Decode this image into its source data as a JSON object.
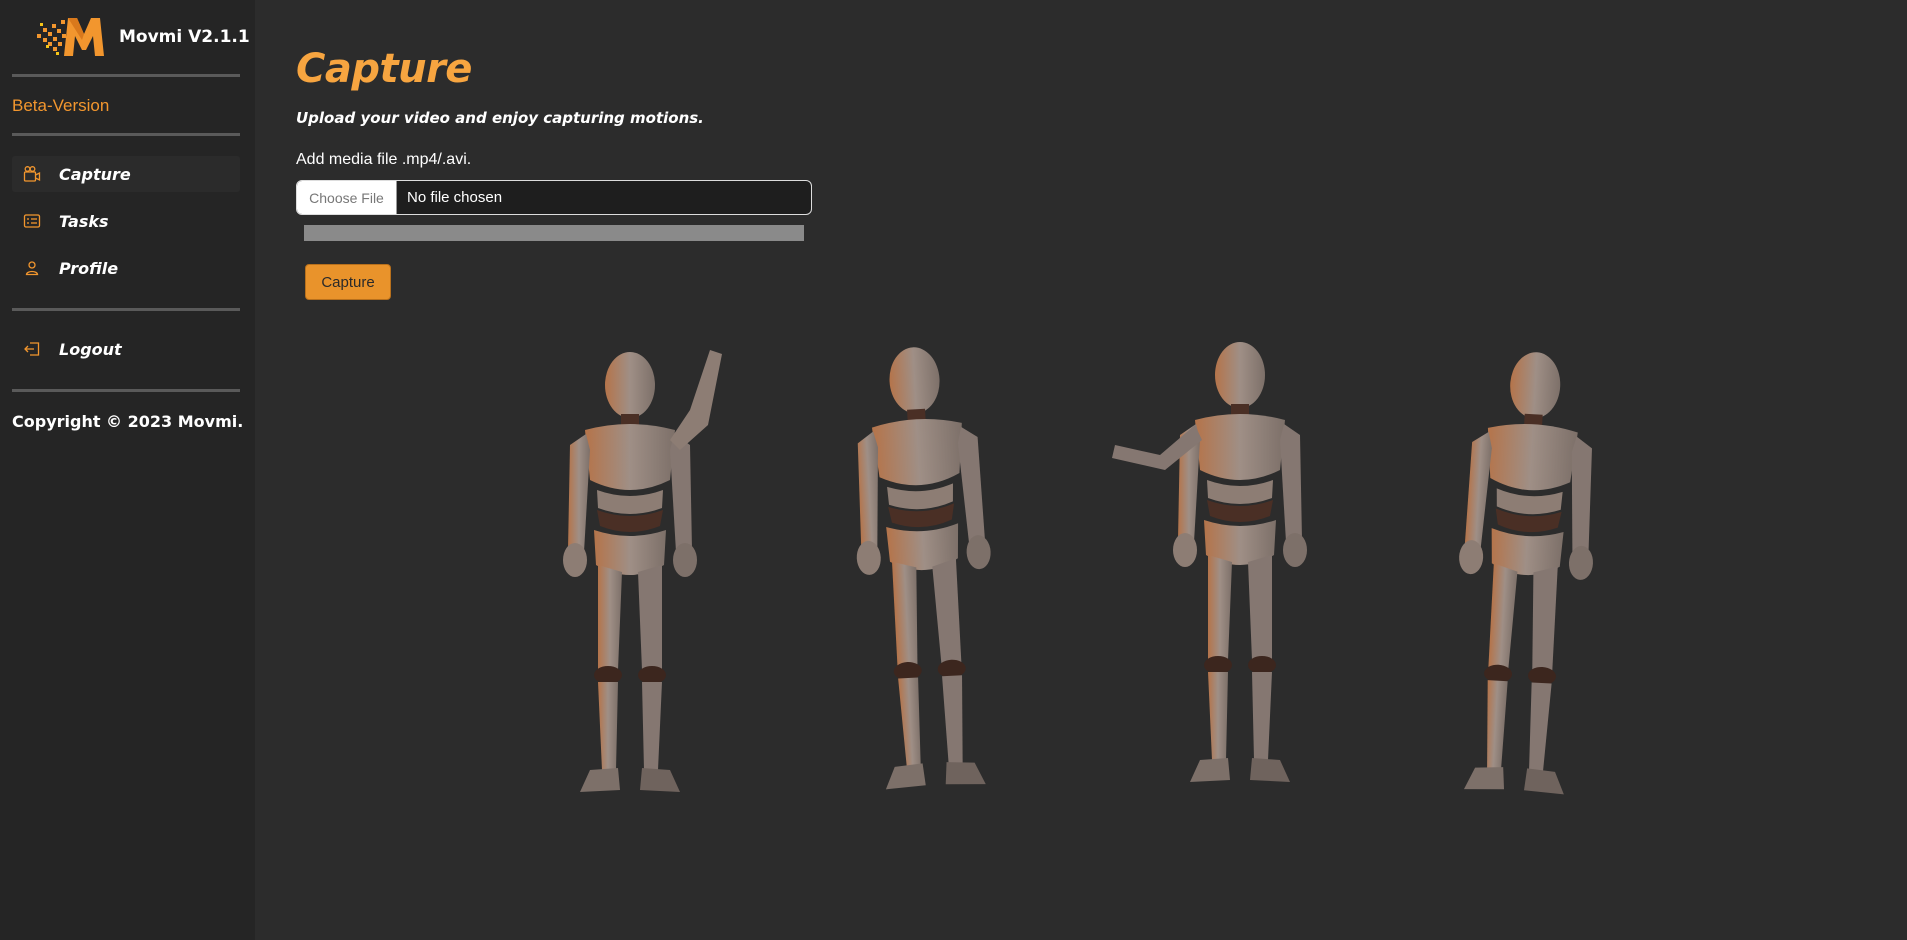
{
  "brand": {
    "name": "Movmi V2.1.1",
    "logo_icon": "movmi-m-logo",
    "logo_letter": "M"
  },
  "sidebar": {
    "beta_label": "Beta-Version",
    "items": [
      {
        "label": "Capture",
        "icon": "video-camera-icon",
        "active": true
      },
      {
        "label": "Tasks",
        "icon": "task-list-icon",
        "active": false
      },
      {
        "label": "Profile",
        "icon": "user-icon",
        "active": false
      }
    ],
    "logout": {
      "label": "Logout",
      "icon": "logout-icon"
    },
    "copyright": "Copyright © 2023 Movmi."
  },
  "main": {
    "title": "Capture",
    "subtitle": "Upload your video and enjoy capturing motions.",
    "file_label": "Add media file .mp4/.avi.",
    "choose_file_label": "Choose File",
    "file_status": "No file chosen",
    "upload_progress": 0,
    "capture_button": "Capture",
    "illustration_icon": "mannequin-figures"
  },
  "colors": {
    "accent": "#f2962e",
    "background": "#2c2c2c",
    "sidebar": "#252525",
    "button": "#e9932b"
  }
}
